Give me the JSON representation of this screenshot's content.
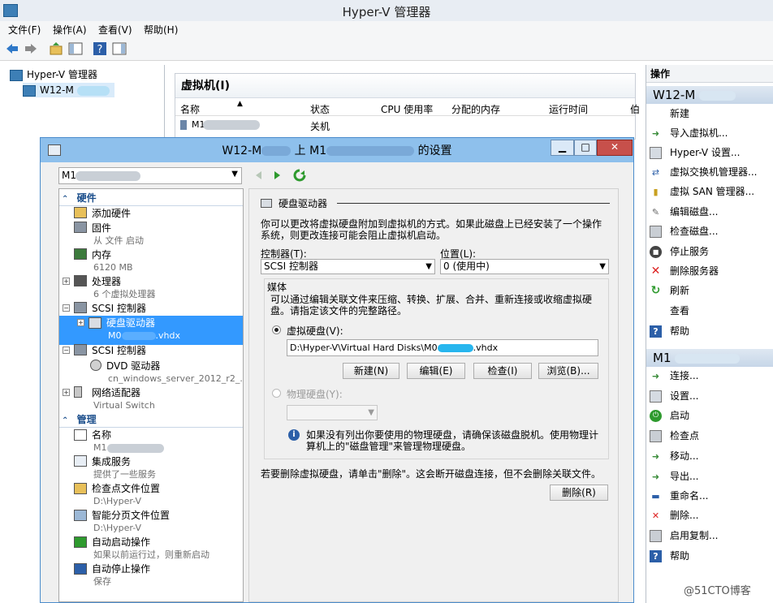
{
  "main_window": {
    "title": "Hyper-V 管理器",
    "menu": [
      "文件(F)",
      "操作(A)",
      "查看(V)",
      "帮助(H)"
    ]
  },
  "left_tree": {
    "root": "Hyper-V 管理器",
    "server_prefix": "W12-M"
  },
  "vm_panel": {
    "title": "虚拟机(I)",
    "columns": [
      "名称",
      "状态",
      "CPU 使用率",
      "分配的内存",
      "运行时间",
      "伯"
    ],
    "rows": [
      {
        "name_prefix": "M1",
        "state": "关机"
      }
    ]
  },
  "actions": {
    "header": "操作",
    "server_section": "W12-M",
    "server_items": [
      "新建",
      "导入虚拟机...",
      "Hyper-V 设置...",
      "虚拟交换机管理器...",
      "虚拟 SAN 管理器...",
      "编辑磁盘...",
      "检查磁盘...",
      "停止服务",
      "删除服务器",
      "刷新",
      "查看",
      "帮助"
    ],
    "vm_section": "M1",
    "vm_items": [
      "连接...",
      "设置...",
      "启动",
      "检查点",
      "移动...",
      "导出...",
      "重命名...",
      "删除...",
      "启用复制...",
      "帮助"
    ]
  },
  "dialog": {
    "title_part1": "W12-M",
    "title_part2": "上 M1",
    "title_part3": "的设置",
    "vm_select_prefix": "M1",
    "hardware_group": "硬件",
    "management_group": "管理",
    "tree": {
      "add_hardware": "添加硬件",
      "firmware": "固件",
      "firmware_sub": "从 文件 启动",
      "memory": "内存",
      "memory_sub": "6120 MB",
      "processor": "处理器",
      "processor_sub": "6 个虚拟处理器",
      "scsi1": "SCSI 控制器",
      "hdd": "硬盘驱动器",
      "hdd_sub_prefix": "M0",
      "hdd_sub_suffix": ".vhdx",
      "scsi2": "SCSI 控制器",
      "dvd": "DVD 驱动器",
      "dvd_sub": "cn_windows_server_2012_r2_...",
      "nic": "网络适配器",
      "nic_sub": "Virtual Switch",
      "name": "名称",
      "name_sub": "M1",
      "integration": "集成服务",
      "integration_sub": "提供了一些服务",
      "checkpoint_loc": "检查点文件位置",
      "checkpoint_loc_sub": "D:\\Hyper-V",
      "paging_loc": "智能分页文件位置",
      "paging_loc_sub": "D:\\Hyper-V",
      "auto_start": "自动启动操作",
      "auto_start_sub": "如果以前运行过，则重新启动",
      "auto_stop": "自动停止操作",
      "auto_stop_sub": "保存"
    },
    "panel": {
      "heading": "硬盘驱动器",
      "description": "你可以更改将虚拟硬盘附加到虚拟机的方式。如果此磁盘上已经安装了一个操作系统，则更改连接可能会阻止虚拟机启动。",
      "controller_label": "控制器(T):",
      "controller_value": "SCSI 控制器",
      "location_label": "位置(L):",
      "location_value": "0 (使用中)",
      "media_label": "媒体",
      "media_desc": "可以通过编辑关联文件来压缩、转换、扩展、合并、重新连接或收缩虚拟硬盘。请指定该文件的完整路径。",
      "vhd_radio": "虚拟硬盘(V):",
      "vhd_path_prefix": "D:\\Hyper-V\\Virtual Hard Disks\\M0",
      "vhd_path_suffix": ".vhdx",
      "btn_new": "新建(N)",
      "btn_edit": "编辑(E)",
      "btn_inspect": "检查(I)",
      "btn_browse": "浏览(B)...",
      "physical_radio": "物理硬盘(Y):",
      "info_text": "如果没有列出你要使用的物理硬盘，请确保该磁盘脱机。使用物理计算机上的\"磁盘管理\"来管理物理硬盘。",
      "remove_text": "若要删除虚拟硬盘，请单击\"删除\"。这会断开磁盘连接，但不会删除关联文件。",
      "btn_remove": "删除(R)"
    }
  },
  "watermark": "@51CTO博客"
}
